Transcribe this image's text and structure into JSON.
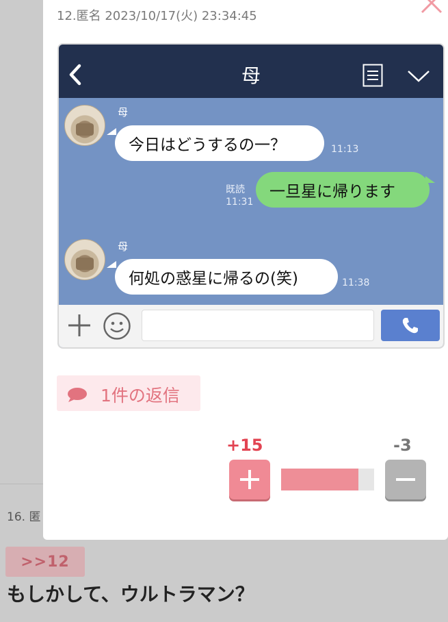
{
  "background": {
    "post16_label": "16. 匿",
    "anchor_text": ">>12",
    "post16_body": "もしかして、ウルトラマン？"
  },
  "post": {
    "meta": "12.匿名 2023/10/17(火) 23:34:45"
  },
  "chat": {
    "title": "母",
    "messages": [
      {
        "direction": "in",
        "sender": "母",
        "text": "今日はどうするの一？",
        "time": "11:13"
      },
      {
        "direction": "out",
        "read_label": "既読",
        "text": "一旦星に帰ります",
        "time": "11:31"
      },
      {
        "direction": "in",
        "sender": "母",
        "text": "何処の惑星に帰るの(笑)",
        "time": "11:38"
      }
    ],
    "input_placeholder": ""
  },
  "replies": {
    "label": "1件の返信"
  },
  "votes": {
    "plus": "+15",
    "minus": "-3",
    "positive_ratio": 0.83
  },
  "colors": {
    "accent_pink": "#e2737f",
    "chat_header": "#22304e",
    "chat_background": "#7493c4",
    "bubble_out": "#84d87c"
  }
}
